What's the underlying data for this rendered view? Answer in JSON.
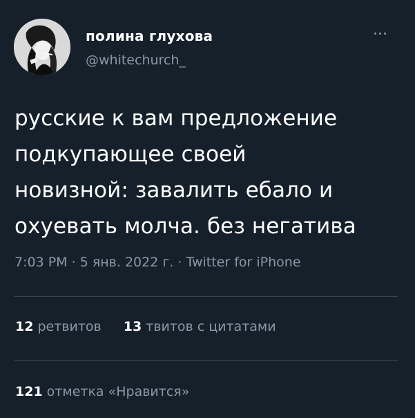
{
  "author": {
    "name": "полина глухова",
    "handle": "@whitechurch_"
  },
  "tweet": {
    "text": "русские к вам предложение\nподкупающее своей\nновизной: завалить ебало и\nохуевать молча. без негатива",
    "time": "7:03 PM",
    "date": "5 янв. 2022 г.",
    "separator": " · ",
    "source": "Twitter for iPhone"
  },
  "stats": {
    "retweets_count": "12",
    "retweets_label": "ретвитов",
    "quotes_count": "13",
    "quotes_label": "твитов с цитатами",
    "likes_count": "121",
    "likes_label": "отметка «Нравится»"
  },
  "icons": {
    "more": "more-horizontal-icon"
  },
  "colors": {
    "background": "#15202b",
    "primary_text": "#ffffff",
    "secondary_text": "#8b98a5",
    "divider": "#38444d"
  }
}
